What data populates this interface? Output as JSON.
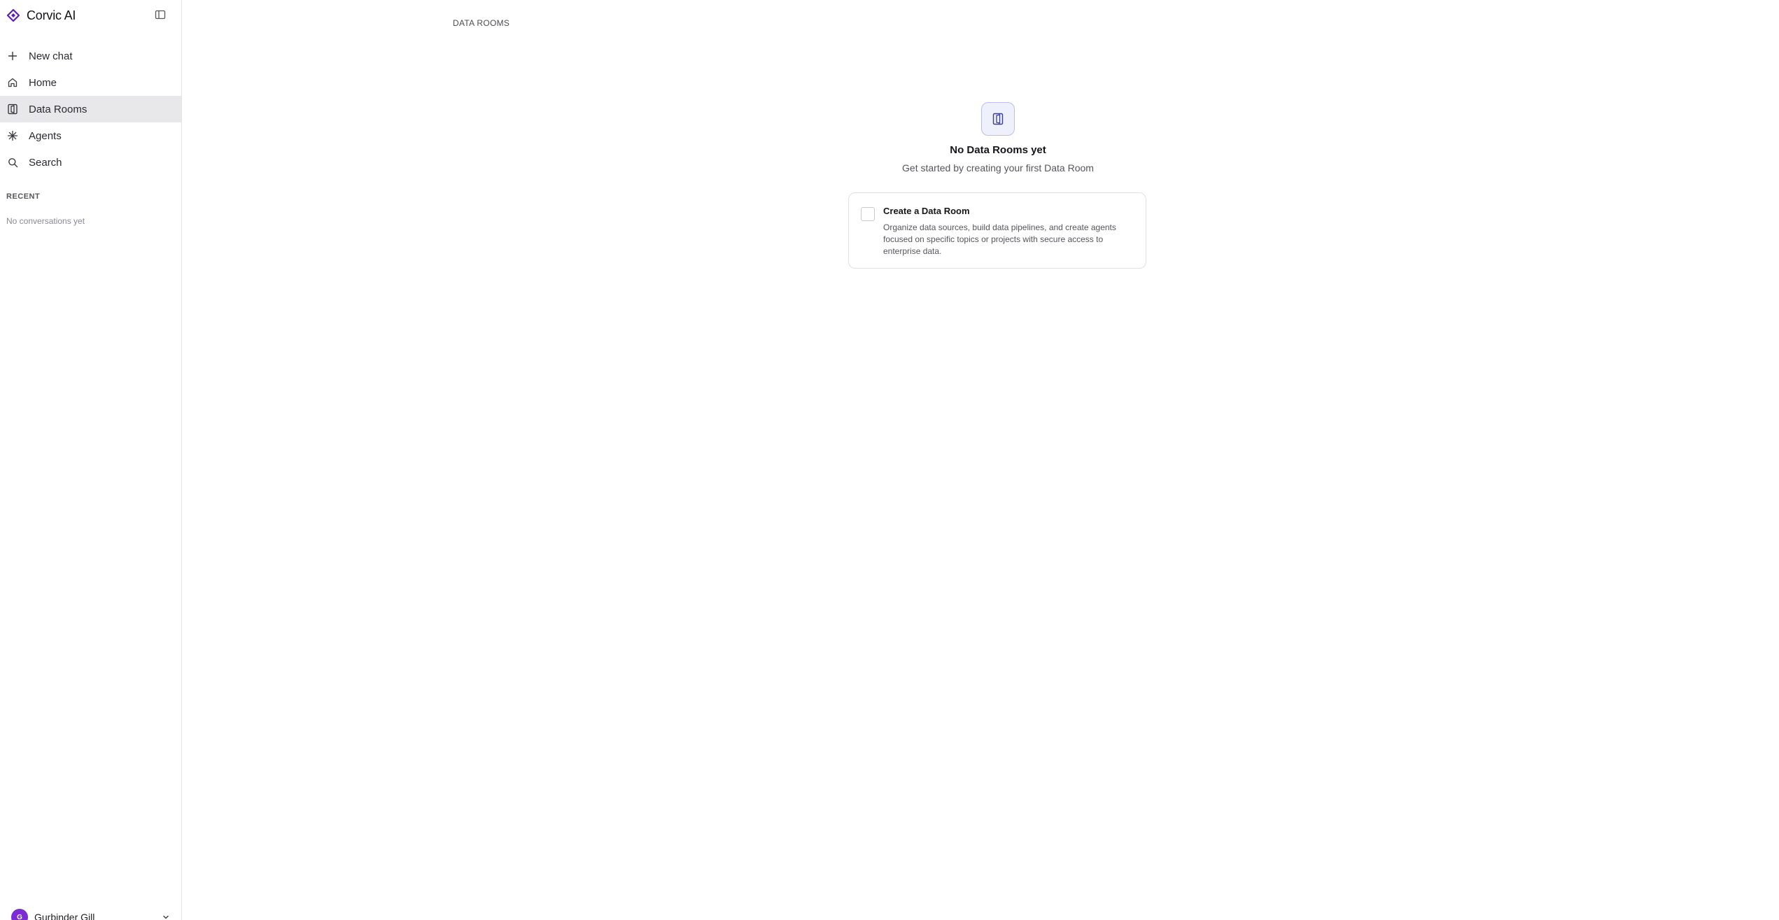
{
  "app": {
    "brand_name": "Corvic AI",
    "brand_icon": "diamond-logo-icon",
    "accent_color": "#5b21b6"
  },
  "sidebar": {
    "collapse_icon": "sidebar-toggle-icon",
    "items": [
      {
        "label": "New chat",
        "icon": "plus-icon"
      },
      {
        "label": "Home",
        "icon": "home-icon"
      },
      {
        "label": "Data Rooms",
        "icon": "data-room-icon",
        "active": true
      },
      {
        "label": "Agents",
        "icon": "asterisk-icon"
      },
      {
        "label": "Search",
        "icon": "search-icon"
      }
    ],
    "recent_heading": "RECENT",
    "recent_empty": "No conversations yet"
  },
  "user": {
    "initial": "G",
    "name": "Gurbinder Gill",
    "avatar_color": "#7c2cd6"
  },
  "main": {
    "breadcrumb": "DATA ROOMS",
    "empty_title": "No Data Rooms yet",
    "empty_subtitle": "Get started by creating your first Data Room",
    "card": {
      "title": "Create a Data Room",
      "description": "Organize data sources, build data pipelines, and create agents focused on specific topics or projects with secure access to enterprise data."
    }
  }
}
